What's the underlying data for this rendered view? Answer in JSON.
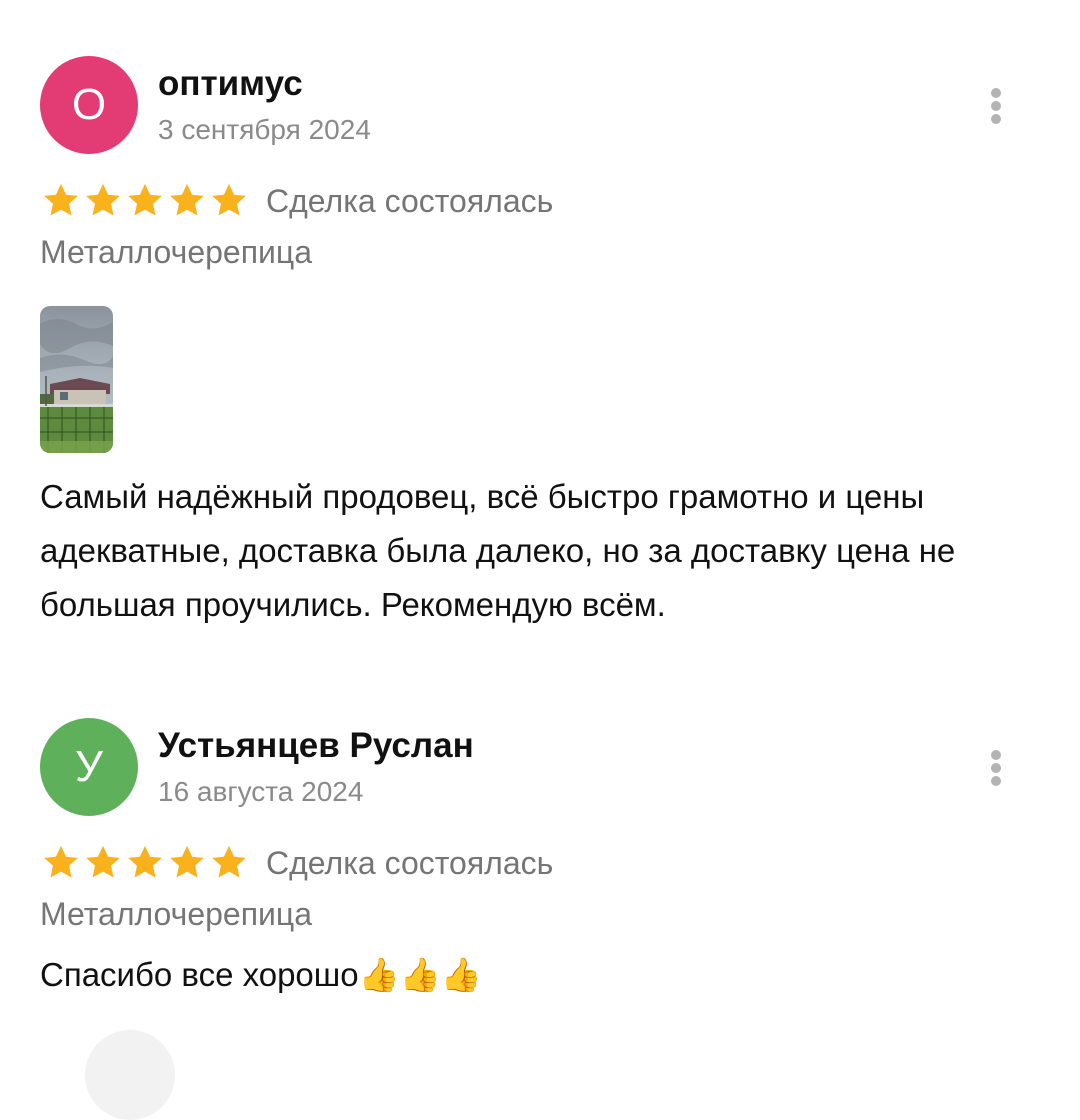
{
  "reviews": [
    {
      "avatar_letter": "О",
      "avatar_color": "#e33b73",
      "author": "оптимус",
      "date": "3 сентября 2024",
      "rating": 5,
      "deal_status": "Сделка состоялась",
      "category": "Металлочерепица",
      "has_photo": true,
      "text": "Самый надёжный продовец, всё быстро грамотно и цены адекватные, доставка была далеко, но за доставку цена не большая проучились. Рекомендую всём."
    },
    {
      "avatar_letter": "У",
      "avatar_color": "#5fb05b",
      "author": "Устьянцев Руслан",
      "date": "16 августа 2024",
      "rating": 5,
      "deal_status": "Сделка состоялась",
      "category": "Металлочерепица",
      "has_photo": false,
      "text": "Спасибо все хорошо👍👍👍"
    }
  ],
  "colors": {
    "star": "#f9b21c",
    "secondary_text": "#757575",
    "menu_dots": "#b3b3b3"
  },
  "icons": {
    "menu": "more-vertical-icon",
    "rating": "star-icon"
  }
}
